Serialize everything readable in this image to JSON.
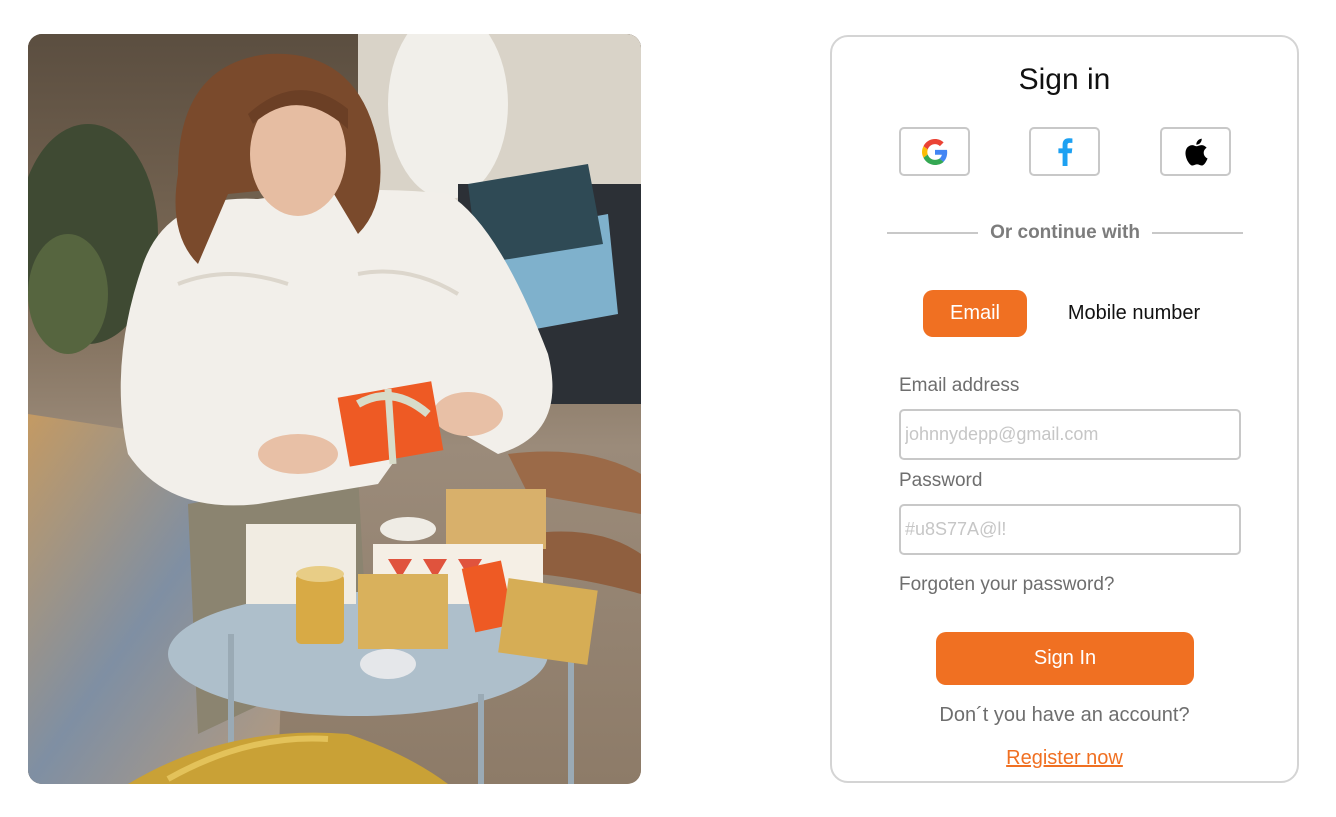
{
  "hero": {
    "icon": "photo-woman-wrapping-gifts"
  },
  "signin": {
    "title": "Sign in",
    "social": [
      {
        "name": "google",
        "icon": "google-icon"
      },
      {
        "name": "facebook",
        "icon": "facebook-icon"
      },
      {
        "name": "apple",
        "icon": "apple-icon"
      }
    ],
    "divider_text": "Or continue with",
    "tabs": [
      {
        "label": "Email",
        "active": true
      },
      {
        "label": "Mobile number",
        "active": false
      }
    ],
    "email_label": "Email address",
    "email_placeholder": "johnnydepp@gmail.com",
    "password_label": "Password",
    "password_placeholder": "#u8S77A@l!",
    "forgot_label": "Forgoten your password?",
    "submit_label": "Sign In",
    "no_account_text": "Don´t you have an account?",
    "register_label": "Register now"
  },
  "colors": {
    "accent": "#f07022",
    "border": "#c8c8c8",
    "muted_text": "#6e6e6e",
    "facebook_blue": "#1da1f2"
  }
}
